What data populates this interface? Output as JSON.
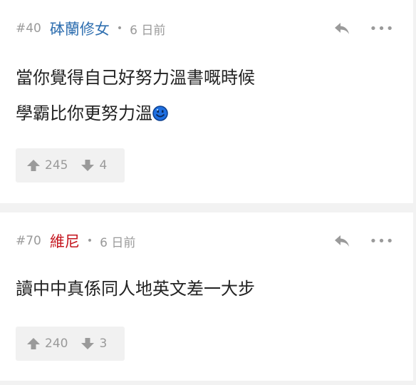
{
  "posts": [
    {
      "number": "#40",
      "username": "砵蘭修女",
      "username_color": "#2f6fb0",
      "time_ago": "6 日前",
      "body_lines": [
        "當你覺得自己好努力溫書嘅時候",
        "學霸比你更努力溫"
      ],
      "body_emoji": "smile-emoji-icon",
      "upvotes": "245",
      "downvotes": "4"
    },
    {
      "number": "#70",
      "username": "維尼",
      "username_color": "#c4141d",
      "time_ago": "6 日前",
      "body_lines": [
        "讀中中真係同人地英文差一大步"
      ],
      "upvotes": "240",
      "downvotes": "3"
    }
  ],
  "meta_separator": "•",
  "more_label": "•••",
  "colors": {
    "muted": "#9a9a9a",
    "background": "#f2f2f2",
    "card": "#ffffff",
    "vote_box": "#f1f1f1",
    "emoji_blue": "#1f6fe0"
  }
}
